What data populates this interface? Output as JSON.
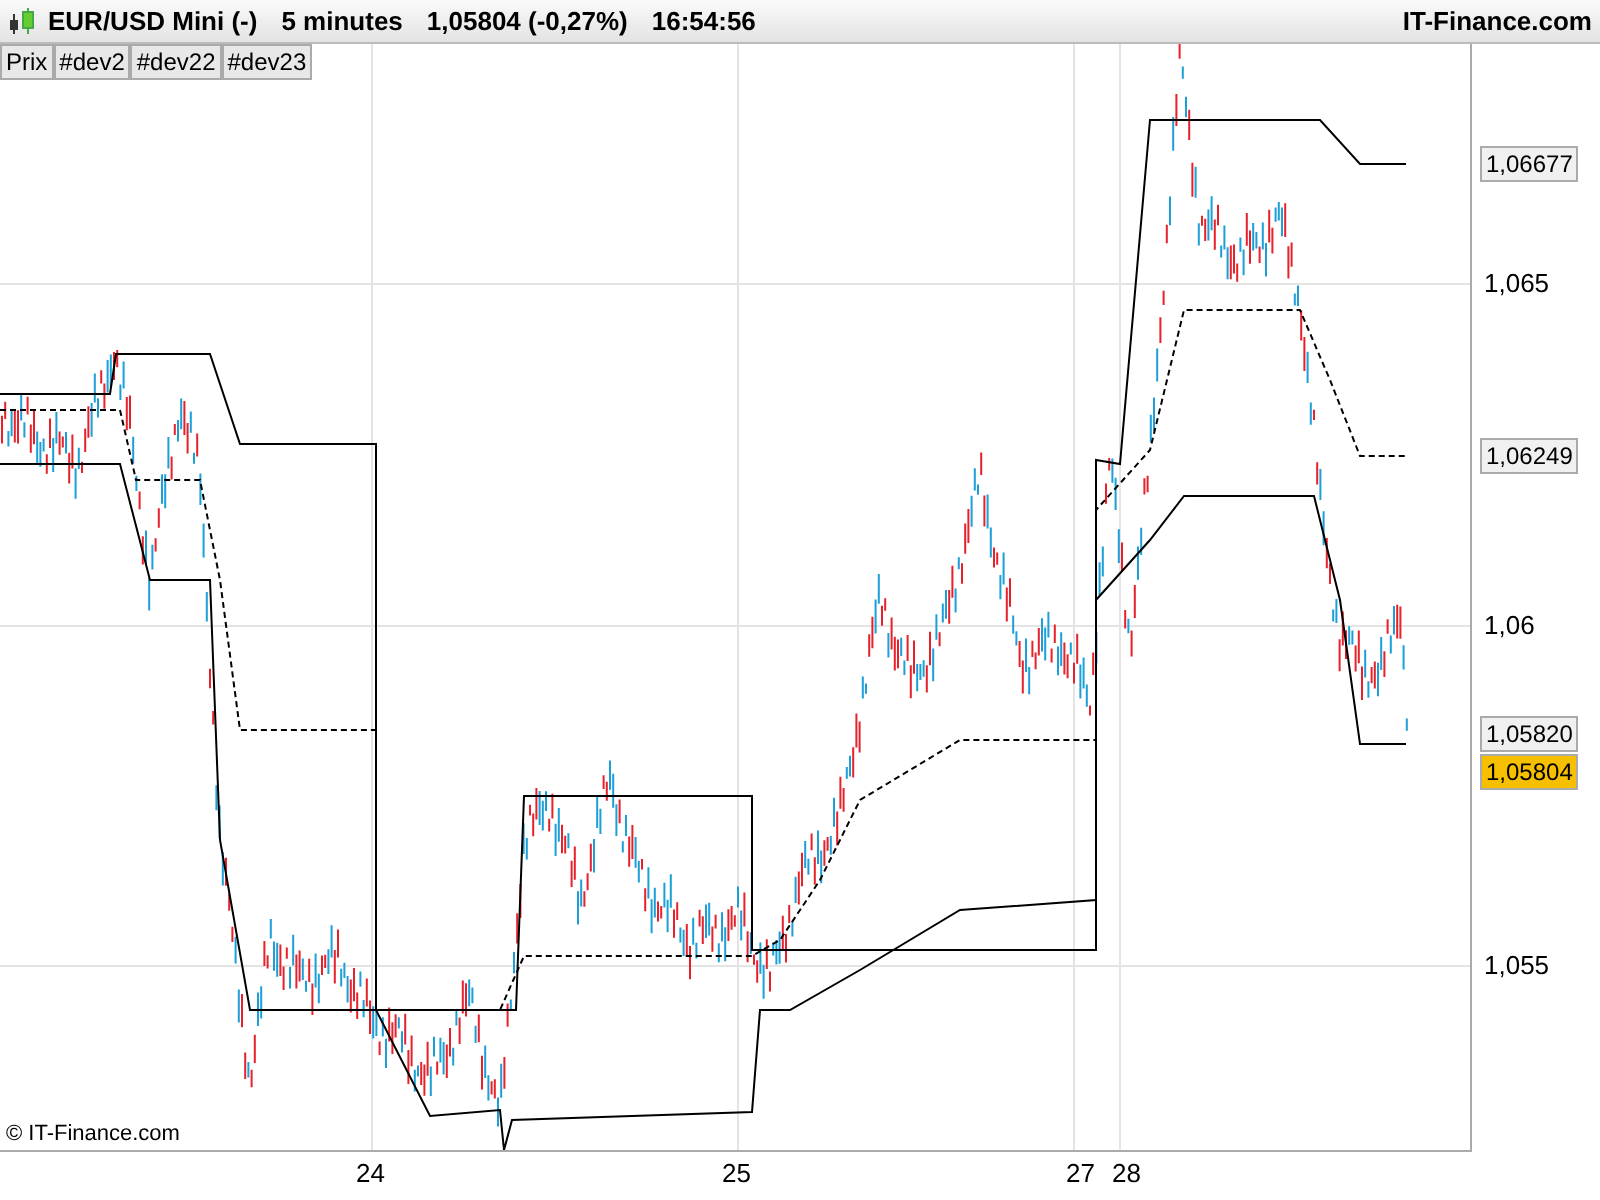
{
  "header": {
    "instrument": "EUR/USD Mini (-)",
    "timeframe": "5 minutes",
    "price": "1,05804 (-0,27%)",
    "time": "16:54:56",
    "brand": "IT-Finance.com"
  },
  "tabs": [
    {
      "label": "Prix"
    },
    {
      "label": "#dev2"
    },
    {
      "label": "#dev22"
    },
    {
      "label": "#dev23"
    }
  ],
  "price_axis": {
    "ticks": [
      "1,065",
      "1,06",
      "1,055"
    ],
    "tags": [
      {
        "label": "1,06677",
        "kind": "level"
      },
      {
        "label": "1,06249",
        "kind": "level"
      },
      {
        "label": "1,05820",
        "kind": "level"
      },
      {
        "label": "1,05804",
        "kind": "last"
      }
    ]
  },
  "time_axis": {
    "ticks": [
      "24",
      "25",
      "27",
      "28"
    ]
  },
  "copyright": "© IT-Finance.com"
}
